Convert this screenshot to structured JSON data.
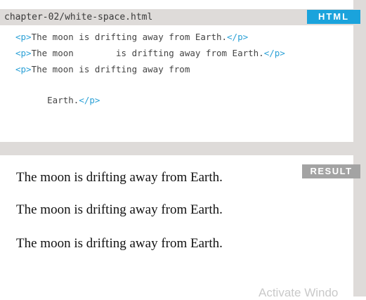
{
  "header": {
    "filename": "chapter-02/white-space.html",
    "html_label": "HTML"
  },
  "code": {
    "lines": [
      {
        "open": "<p>",
        "text": "The moon is drifting away from Earth.",
        "close": "</p>"
      },
      {
        "open": "<p>",
        "text": "The moon        is drifting away from Earth.",
        "close": "</p>"
      },
      {
        "open": "<p>",
        "text": "The moon is drifting away from",
        "close": ""
      },
      {
        "open": "",
        "text": "      Earth.",
        "close": "</p>"
      }
    ]
  },
  "result": {
    "label": "RESULT",
    "lines": [
      "The moon is drifting away from Earth.",
      "The moon is drifting away from Earth.",
      "The moon is drifting away from Earth."
    ]
  },
  "watermark": "Activate Windo",
  "colors": {
    "html_badge": "#1aa3dc",
    "result_badge": "#a3a3a3",
    "tag_color": "#2aa0d6",
    "frame": "#dedbd9"
  }
}
